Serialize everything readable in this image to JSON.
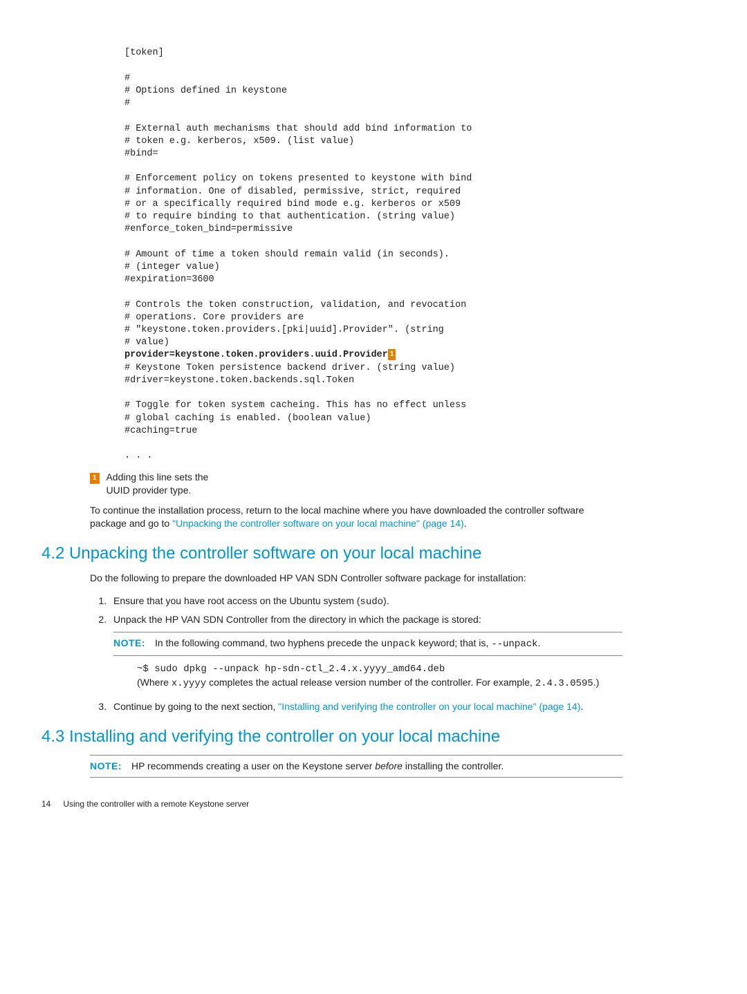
{
  "code": {
    "l1": "[token]",
    "l2": "#",
    "l3": "# Options defined in keystone",
    "l4": "#",
    "l5": "# External auth mechanisms that should add bind information to",
    "l6": "# token e.g. kerberos, x509. (list value)",
    "l7": "#bind=",
    "l8": "# Enforcement policy on tokens presented to keystone with bind",
    "l9": "# information. One of disabled, permissive, strict, required",
    "l10": "# or a specifically required bind mode e.g. kerberos or x509",
    "l11": "# to require binding to that authentication. (string value)",
    "l12": "#enforce_token_bind=permissive",
    "l13": "# Amount of time a token should remain valid (in seconds).",
    "l14": "# (integer value)",
    "l15": "#expiration=3600",
    "l16": "# Controls the token construction, validation, and revocation",
    "l17": "# operations. Core providers are",
    "l18": "# \"keystone.token.providers.[pki|uuid].Provider\". (string",
    "l19": "# value)",
    "l20": "provider=keystone.token.providers.uuid.Provider",
    "l21": "# Keystone Token persistence backend driver. (string value)",
    "l22": "#driver=keystone.token.backends.sql.Token",
    "l23": "# Toggle for token system cacheing. This has no effect unless",
    "l24": "# global caching is enabled. (boolean value)",
    "l25": "#caching=true",
    "l26": ". . ."
  },
  "callout": {
    "marker": "1",
    "text": "Adding this line sets the UUID provider type."
  },
  "para1": {
    "pre": "To continue the installation process, return to the local machine where you have downloaded the controller software package and go to ",
    "link": "\"Unpacking the controller software on your local machine\" (page 14)",
    "post": "."
  },
  "section42": {
    "title": "4.2 Unpacking the controller software on your local machine",
    "intro": "Do the following to prepare the downloaded HP VAN SDN Controller software package for installation:",
    "step1_pre": "Ensure that you have root access on the Ubuntu system (",
    "step1_mono": "sudo",
    "step1_post": ").",
    "step2": "Unpack the HP VAN SDN Controller from the directory in which the package is stored:",
    "note_label": "NOTE:",
    "note_pre": "In the following command, two hyphens precede the ",
    "note_mono1": "unpack",
    "note_mid": " keyword; that is, ",
    "note_mono2": "--unpack",
    "note_post": ".",
    "cmd": "~$ sudo dpkg --unpack hp-sdn-ctl_2.4.x.yyyy_amd64.deb",
    "where_pre": "(Where ",
    "where_mono1": "x.yyyy",
    "where_mid": " completes the actual release version number of the controller. For example, ",
    "where_mono2": "2.4.3.0595",
    "where_post": ".)",
    "step3_pre": "Continue by going to the next section, ",
    "step3_link": "\"Installing and verifying the controller on your local machine\" (page 14)",
    "step3_post": "."
  },
  "section43": {
    "title": "4.3 Installing and verifying the controller on your local machine",
    "note_label": "NOTE:",
    "note_pre": "HP recommends creating a user on the Keystone server ",
    "note_italic": "before",
    "note_post": " installing the controller."
  },
  "footer": {
    "page": "14",
    "text": "Using the controller with a remote Keystone server"
  }
}
